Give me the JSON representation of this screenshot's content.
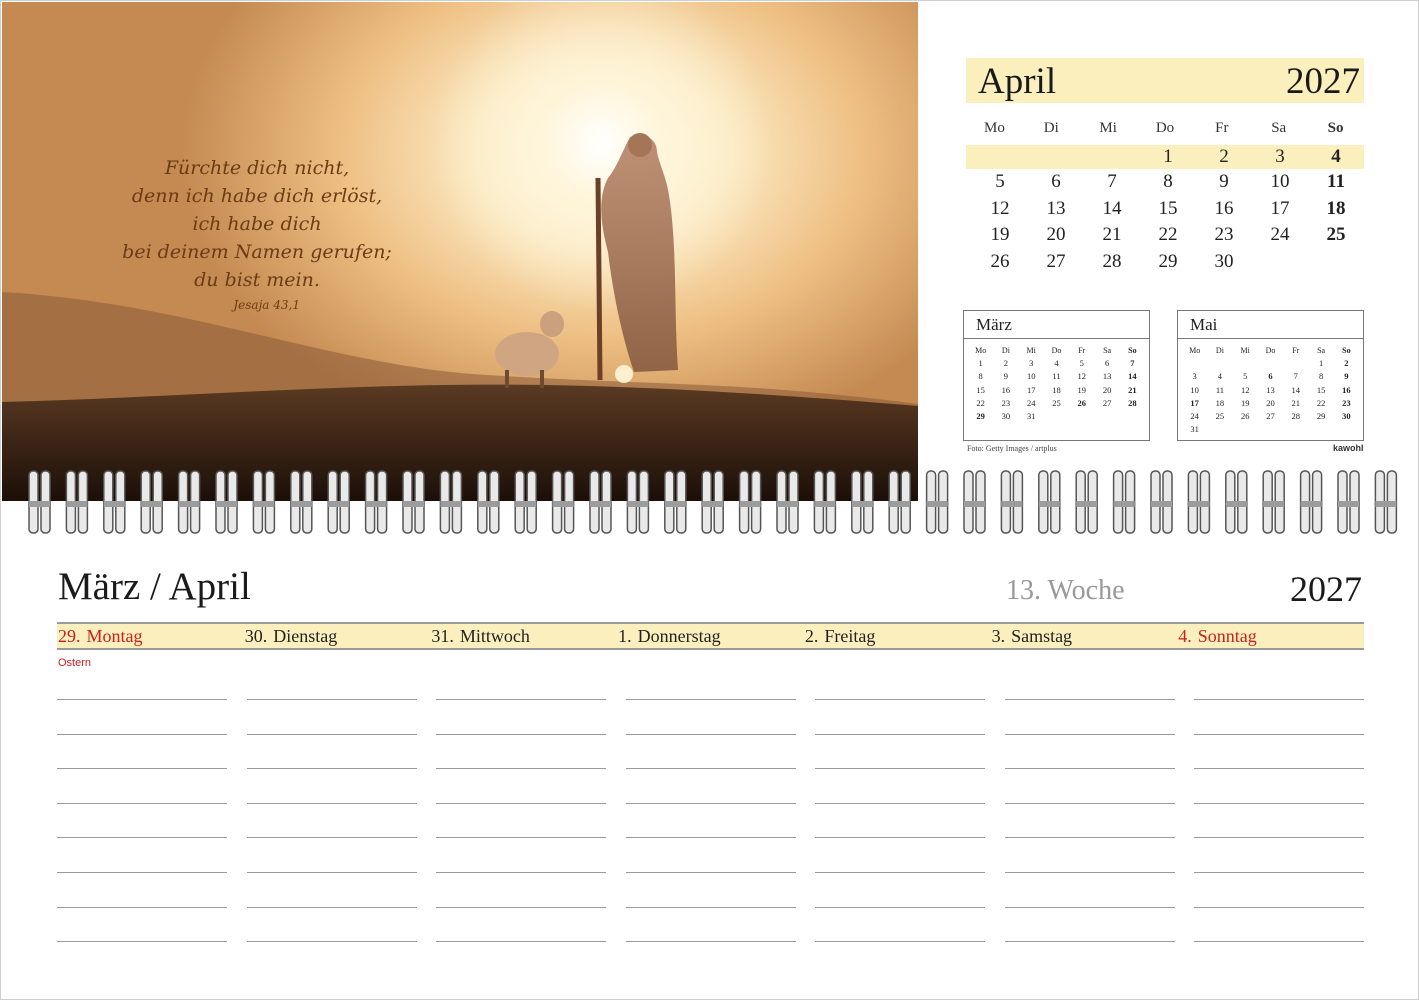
{
  "photo": {
    "quote_lines": [
      "Fürchte dich nicht,",
      "denn ich habe dich erlöst,",
      "ich habe dich",
      "bei deinem Namen gerufen;",
      "du bist mein."
    ],
    "quote_ref": "Jesaja 43,1"
  },
  "month": {
    "name": "April",
    "year": "2027",
    "weekdays": [
      "Mo",
      "Di",
      "Mi",
      "Do",
      "Fr",
      "Sa",
      "So"
    ],
    "weeks": [
      [
        "",
        "",
        "",
        "1",
        "2",
        "3",
        "4"
      ],
      [
        "5",
        "6",
        "7",
        "8",
        "9",
        "10",
        "11"
      ],
      [
        "12",
        "13",
        "14",
        "15",
        "16",
        "17",
        "18"
      ],
      [
        "19",
        "20",
        "21",
        "22",
        "23",
        "24",
        "25"
      ],
      [
        "26",
        "27",
        "28",
        "29",
        "30",
        "",
        ""
      ]
    ]
  },
  "mini_march": {
    "name": "März",
    "weekdays": [
      "Mo",
      "Di",
      "Mi",
      "Do",
      "Fr",
      "Sa",
      "So"
    ],
    "weeks": [
      [
        "1",
        "2",
        "3",
        "4",
        "5",
        "6",
        "7"
      ],
      [
        "8",
        "9",
        "10",
        "11",
        "12",
        "13",
        "14"
      ],
      [
        "15",
        "16",
        "17",
        "18",
        "19",
        "20",
        "21"
      ],
      [
        "22",
        "23",
        "24",
        "25",
        "26",
        "27",
        "28"
      ],
      [
        "29",
        "30",
        "31",
        "",
        "",
        "",
        ""
      ]
    ],
    "bold": [
      "7",
      "14",
      "21",
      "26",
      "28",
      "29"
    ]
  },
  "mini_may": {
    "name": "Mai",
    "weekdays": [
      "Mo",
      "Di",
      "Mi",
      "Do",
      "Fr",
      "Sa",
      "So"
    ],
    "weeks": [
      [
        "",
        "",
        "",
        "",
        "",
        "1",
        "2"
      ],
      [
        "3",
        "4",
        "5",
        "6",
        "7",
        "8",
        "9"
      ],
      [
        "10",
        "11",
        "12",
        "13",
        "14",
        "15",
        "16"
      ],
      [
        "17",
        "18",
        "19",
        "20",
        "21",
        "22",
        "23"
      ],
      [
        "24",
        "25",
        "26",
        "27",
        "28",
        "29",
        "30"
      ],
      [
        "31",
        "",
        "",
        "",
        "",
        "",
        ""
      ]
    ],
    "bold": [
      "2",
      "6",
      "9",
      "16",
      "17",
      "23",
      "30"
    ]
  },
  "credit": "Foto: Getty Images / artplus",
  "brand": "kawohl",
  "week": {
    "title": "März / April",
    "week_label": "13. Woche",
    "year": "2027",
    "days": [
      {
        "num": "29.",
        "name": "Montag",
        "red": true
      },
      {
        "num": "30.",
        "name": "Dienstag",
        "red": false
      },
      {
        "num": "31.",
        "name": "Mittwoch",
        "red": false
      },
      {
        "num": "1.",
        "name": "Donnerstag",
        "red": false
      },
      {
        "num": "2.",
        "name": "Freitag",
        "red": false
      },
      {
        "num": "3.",
        "name": "Samstag",
        "red": false
      },
      {
        "num": "4.",
        "name": "Sonntag",
        "red": true
      }
    ],
    "holiday": "Ostern"
  },
  "colors": {
    "highlight": "#fcefbe",
    "holiday_red": "#c8201f",
    "rule_gray": "#9a9a9a"
  }
}
